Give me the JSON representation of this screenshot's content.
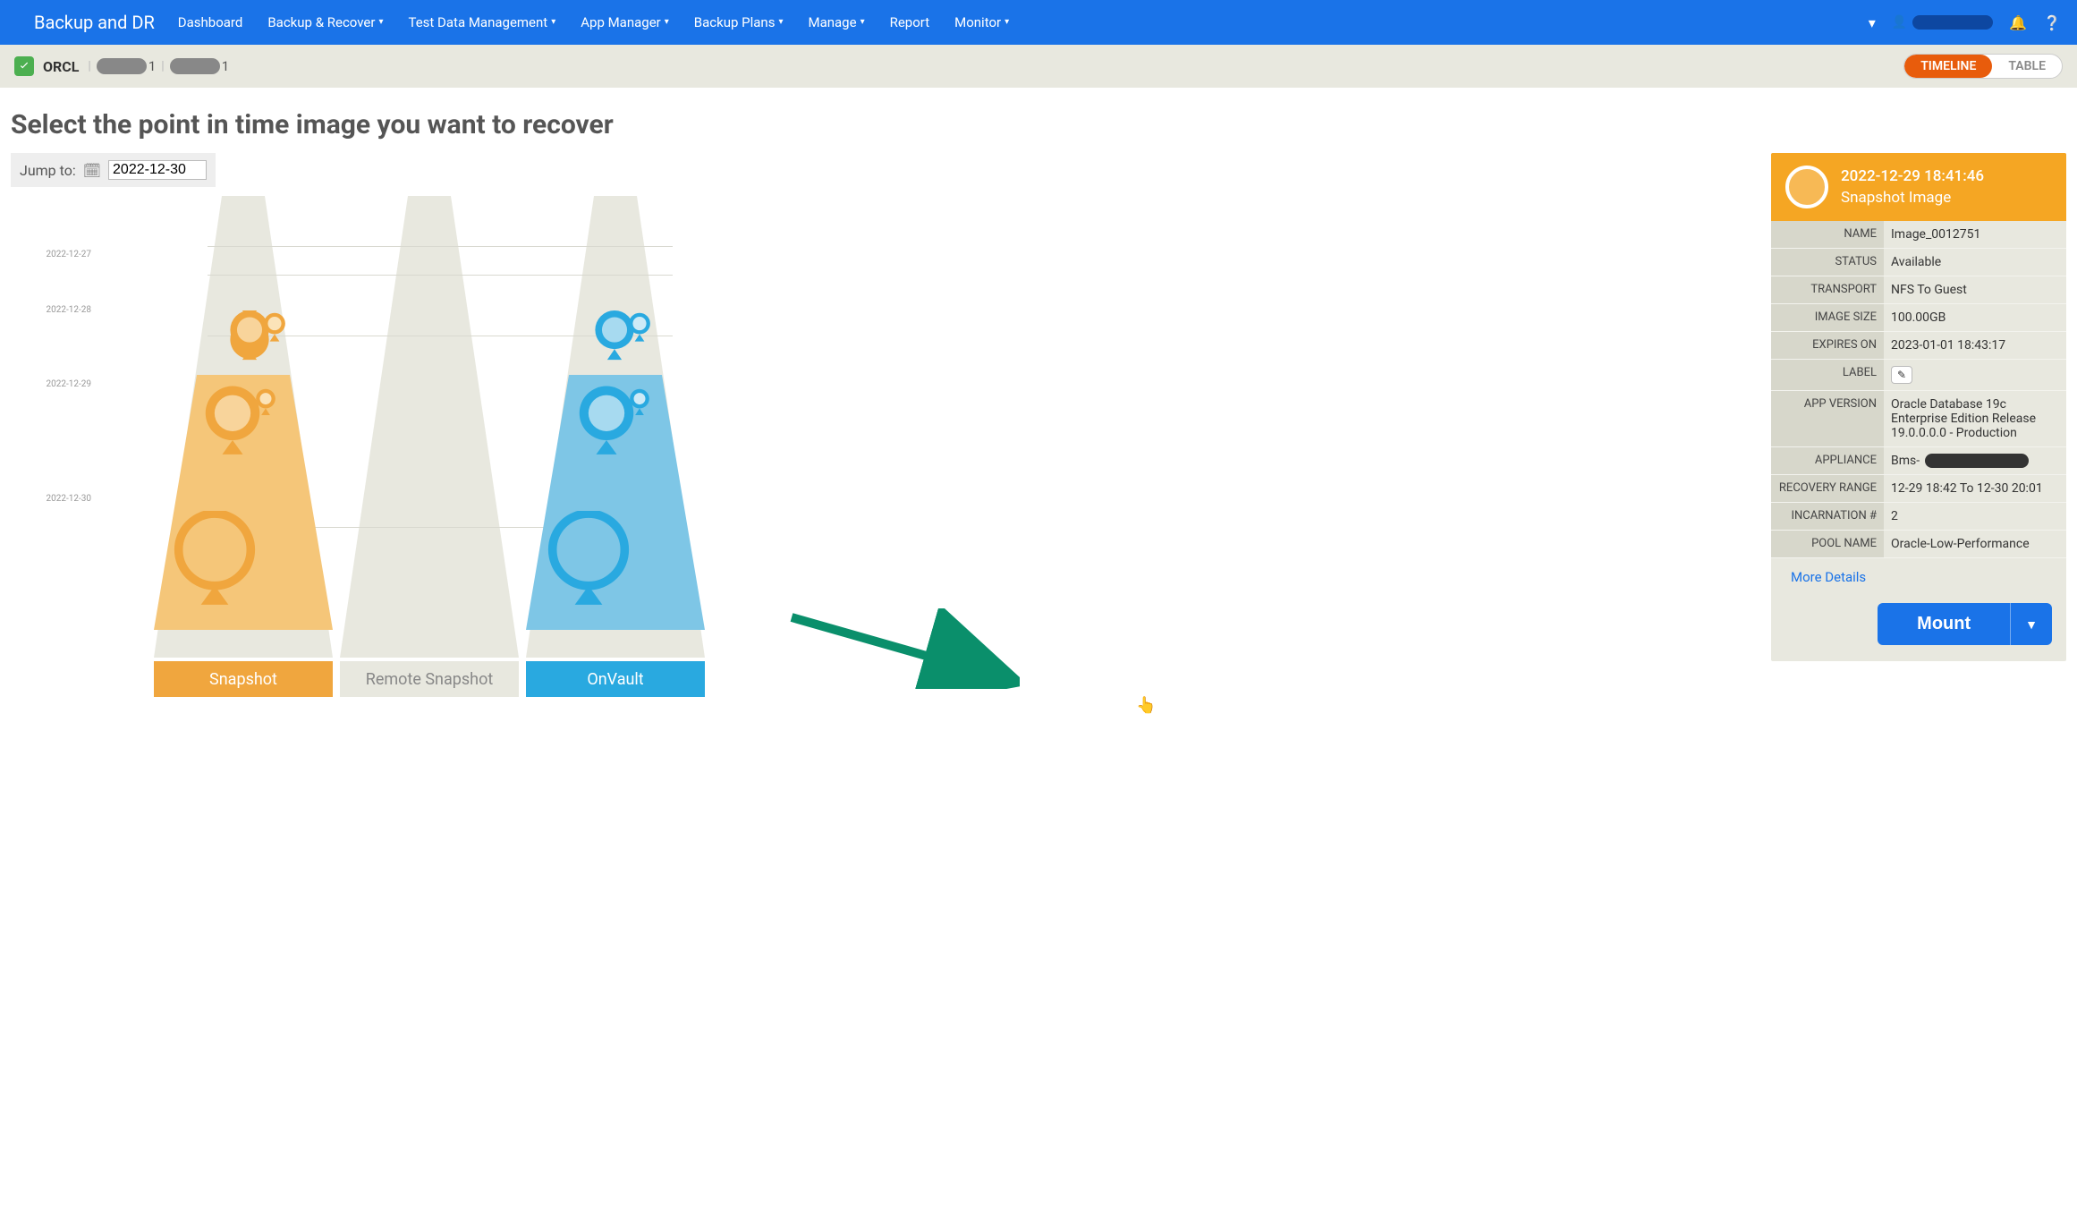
{
  "nav": {
    "brand": "Backup and DR",
    "items": [
      "Dashboard",
      "Backup & Recover",
      "Test Data Management",
      "App Manager",
      "Backup Plans",
      "Manage",
      "Report",
      "Monitor"
    ],
    "has_caret": [
      false,
      true,
      true,
      true,
      true,
      true,
      false,
      true
    ]
  },
  "subheader": {
    "app": "ORCL",
    "tail1": "1",
    "tail2": "1",
    "toggle_timeline": "TIMELINE",
    "toggle_table": "TABLE"
  },
  "title": "Select the point in time image you want to recover",
  "jump": {
    "label": "Jump to:",
    "value": "2022-12-30"
  },
  "timeline": {
    "dates": [
      "2022-12-27",
      "2022-12-28",
      "2022-12-29",
      "2022-12-30"
    ],
    "lanes": {
      "snapshot": "Snapshot",
      "remote": "Remote Snapshot",
      "onvault": "OnVault"
    }
  },
  "panel": {
    "datetime": "2022-12-29  18:41:46",
    "type": "Snapshot Image",
    "rows": {
      "name_k": "NAME",
      "name_v": "Image_0012751",
      "status_k": "STATUS",
      "status_v": "Available",
      "transport_k": "TRANSPORT",
      "transport_v": "NFS To Guest",
      "size_k": "IMAGE SIZE",
      "size_v": "100.00GB",
      "expires_k": "EXPIRES ON",
      "expires_v": "2023-01-01 18:43:17",
      "label_k": "LABEL",
      "appver_k": "APP VERSION",
      "appver_v": "Oracle Database 19c Enterprise Edition Release 19.0.0.0.0 - Production",
      "appliance_k": "APPLIANCE",
      "appliance_v": "Bms-",
      "range_k": "RECOVERY RANGE",
      "range_v": "12-29 18:42 To 12-30 20:01",
      "incarn_k": "INCARNATION #",
      "incarn_v": "2",
      "pool_k": "POOL NAME",
      "pool_v": "Oracle-Low-Performance"
    },
    "more": "More Details",
    "mount": "Mount"
  }
}
